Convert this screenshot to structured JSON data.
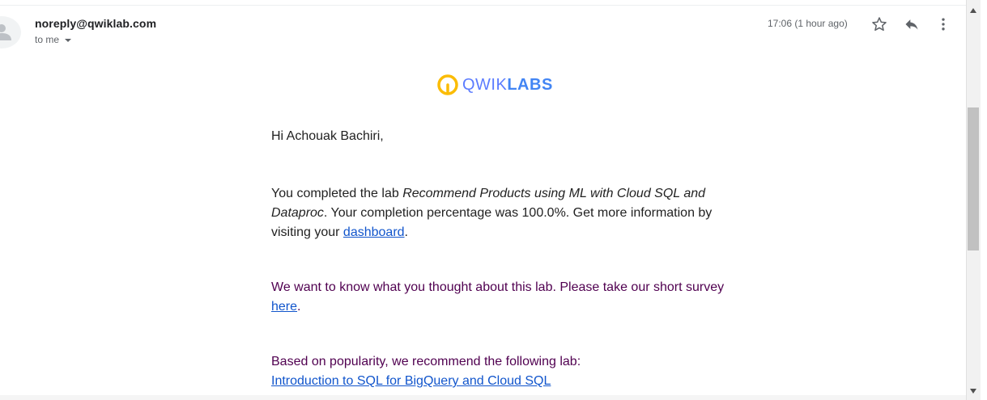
{
  "header": {
    "sender": "noreply@qwiklab.com",
    "recipient": "to me",
    "time": "17:06 (1 hour ago)",
    "icons": [
      "person-icon",
      "star-icon",
      "reply-icon",
      "more-vert-icon"
    ]
  },
  "logo": {
    "part1": "QWIK",
    "part2": "LABS"
  },
  "body": {
    "greeting": "Hi Achouak Bachiri,",
    "p1_intro": "You completed the lab ",
    "p1_lab": "Recommend Products using ML with Cloud SQL and Dataproc",
    "p1_rest": ". Your completion percentage was 100.0%. Get more information by visiting your ",
    "p1_link": "dashboard",
    "p1_end": ".",
    "p2_text": "We want to know what you thought about this lab. Please take our short survey ",
    "p2_link": "here",
    "p2_end": ".",
    "p3_text": "Based on popularity, we recommend the following lab:",
    "p3_link": "Introduction to SQL for BigQuery and Cloud SQL"
  },
  "colors": {
    "link": "#1155cc",
    "quoted_text": "#500050",
    "logo_accent": "#fbbc05",
    "logo_blue": "#4285f4"
  }
}
